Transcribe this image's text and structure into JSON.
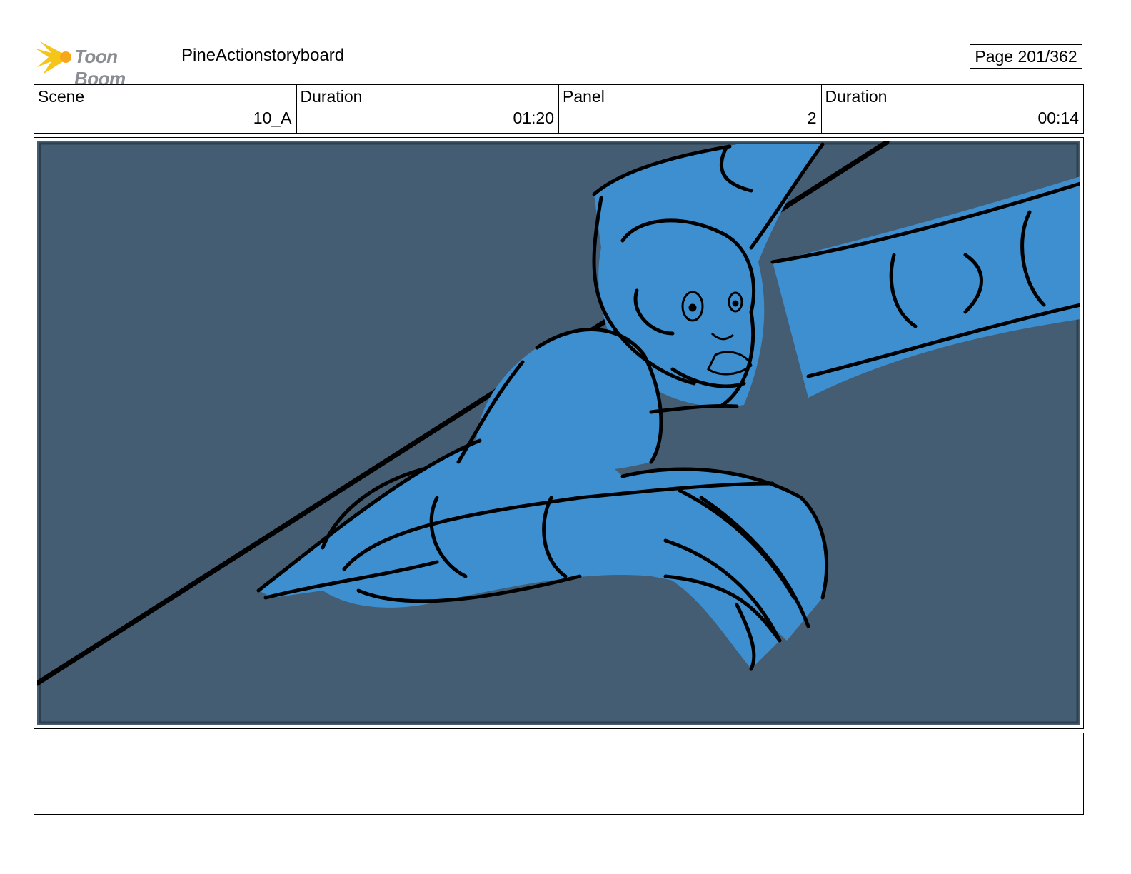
{
  "header": {
    "logo_text": "Toon Boom",
    "logo_icon": "starburst-icon",
    "project_title": "PineActionstoryboard",
    "page_label": "Page 201/362"
  },
  "info": {
    "scene_label": "Scene",
    "scene_value": "10_A",
    "scene_duration_label": "Duration",
    "scene_duration_value": "01:20",
    "panel_label": "Panel",
    "panel_value": "2",
    "panel_duration_label": "Duration",
    "panel_duration_value": "00:14"
  },
  "panel": {
    "background_color": "#445d73",
    "figure_fill_color": "#3d8fd0",
    "line_color": "#000000"
  },
  "notes": {
    "text": ""
  }
}
